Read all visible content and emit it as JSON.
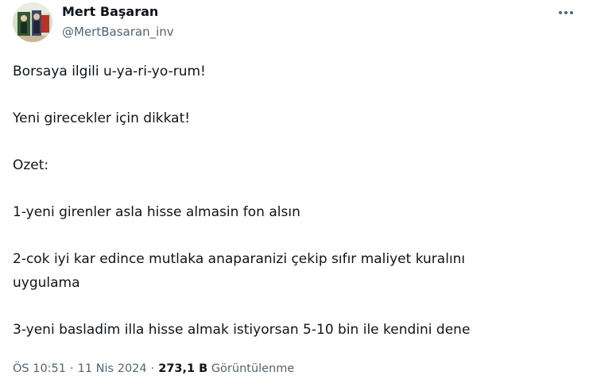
{
  "author": {
    "name": "Mert Başaran",
    "handle": "@MertBasaran_inv"
  },
  "tweet": {
    "paragraphs": [
      "Borsaya ilgili u-ya-ri-yo-rum!",
      "Yeni girecekler için dikkat!",
      "Ozet:",
      "1-yeni girenler asla hisse almasin fon alsın",
      "2-cok iyi kar edince mutlaka anaparanizi çekip sıfır maliyet kuralını\nuygulama",
      "3-yeni basladim illa hisse almak istiyorsan 5-10 bin ile kendini dene"
    ]
  },
  "meta": {
    "time": "ÖS 10:51",
    "separator": "·",
    "date": "11 Nis 2024",
    "views_count": "273,1 B",
    "views_label": "Görüntülenme"
  },
  "icons": {
    "avatar": "profile-photo",
    "more": "more-options-icon"
  },
  "colors": {
    "text_primary": "#0f1419",
    "text_secondary": "#536471"
  }
}
